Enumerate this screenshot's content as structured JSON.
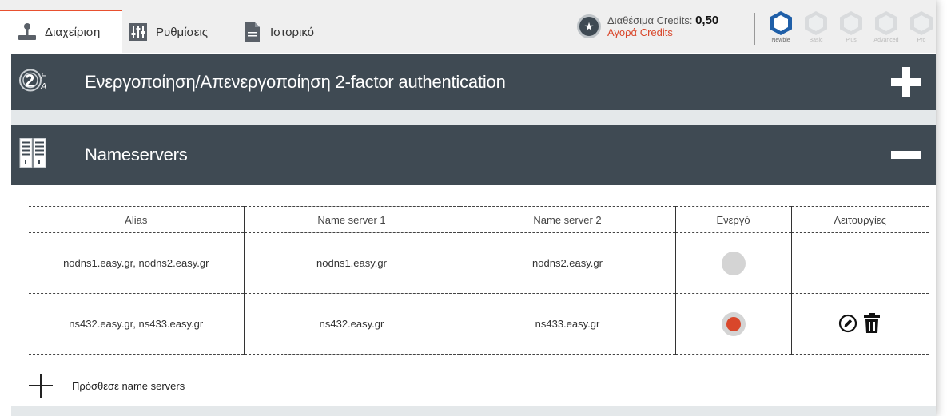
{
  "tabs": [
    {
      "label": "Διαχείριση",
      "icon": "joystick-icon",
      "active": true
    },
    {
      "label": "Ρυθμίσεις",
      "icon": "sliders-icon",
      "active": false
    },
    {
      "label": "Ιστορικό",
      "icon": "document-icon",
      "active": false
    }
  ],
  "credits": {
    "label": "Διαθέσιμα Credits:",
    "value": "0,50",
    "buy_label": "Αγορά Credits"
  },
  "levels": [
    {
      "label": "Newbie",
      "active": true
    },
    {
      "label": "Basic",
      "active": false
    },
    {
      "label": "Plus",
      "active": false
    },
    {
      "label": "Advanced",
      "active": false
    },
    {
      "label": "Pro",
      "active": false
    }
  ],
  "sections": {
    "twofa": {
      "title": "Ενεργοποίηση/Απενεργοποίηση 2-factor authentication",
      "icon": "2fa-fingerprint-icon",
      "expanded": false
    },
    "nameservers": {
      "title": "Nameservers",
      "icon": "server-racks-icon",
      "expanded": true
    }
  },
  "table": {
    "headers": [
      "Alias",
      "Name server 1",
      "Name server 2",
      "Ενεργό",
      "Λειτουργίες"
    ],
    "rows": [
      {
        "alias": "nodns1.easy.gr, nodns2.easy.gr",
        "ns1": "nodns1.easy.gr",
        "ns2": "nodns2.easy.gr",
        "active": false,
        "editable": false
      },
      {
        "alias": "ns432.easy.gr, ns433.easy.gr",
        "ns1": "ns432.easy.gr",
        "ns2": "ns433.easy.gr",
        "active": true,
        "editable": true
      }
    ]
  },
  "add_label": "Πρόσθεσε name servers",
  "colors": {
    "header_bg": "#3f4a53",
    "accent": "#d9472b",
    "badge_active": "#1f5fa8"
  }
}
